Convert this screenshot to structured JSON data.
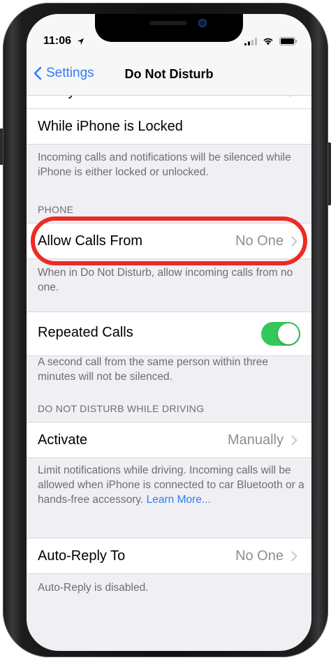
{
  "status_bar": {
    "time": "11:06",
    "icons": [
      "location-arrow-icon",
      "signal-icon",
      "wifi-icon",
      "battery-icon"
    ]
  },
  "nav": {
    "back_label": "Settings",
    "title": "Do Not Disturb"
  },
  "partial_row": {
    "label": "Always"
  },
  "rows": {
    "while_locked": "While iPhone is Locked",
    "while_locked_desc": "Incoming calls and notifications will be silenced while iPhone is either locked or unlocked.",
    "phone_header": "PHONE",
    "allow_calls_label": "Allow Calls From",
    "allow_calls_value": "No One",
    "allow_calls_desc": "When in Do Not Disturb, allow incoming calls from no one.",
    "repeated_calls_label": "Repeated Calls",
    "repeated_calls_on": true,
    "repeated_calls_desc": "A second call from the same person within three minutes will not be silenced.",
    "driving_header": "DO NOT DISTURB WHILE DRIVING",
    "activate_label": "Activate",
    "activate_value": "Manually",
    "activate_desc": "Limit notifications while driving. Incoming calls will be allowed when iPhone is connected to car Bluetooth or a hands-free accessory.",
    "learn_more": "Learn More...",
    "auto_reply_label": "Auto-Reply To",
    "auto_reply_value": "No One",
    "auto_reply_desc": "Auto-Reply is disabled."
  },
  "colors": {
    "accent": "#2f7cf6",
    "toggle_on": "#34c759",
    "annotation": "#ee2a24",
    "background": "#efeff4"
  }
}
